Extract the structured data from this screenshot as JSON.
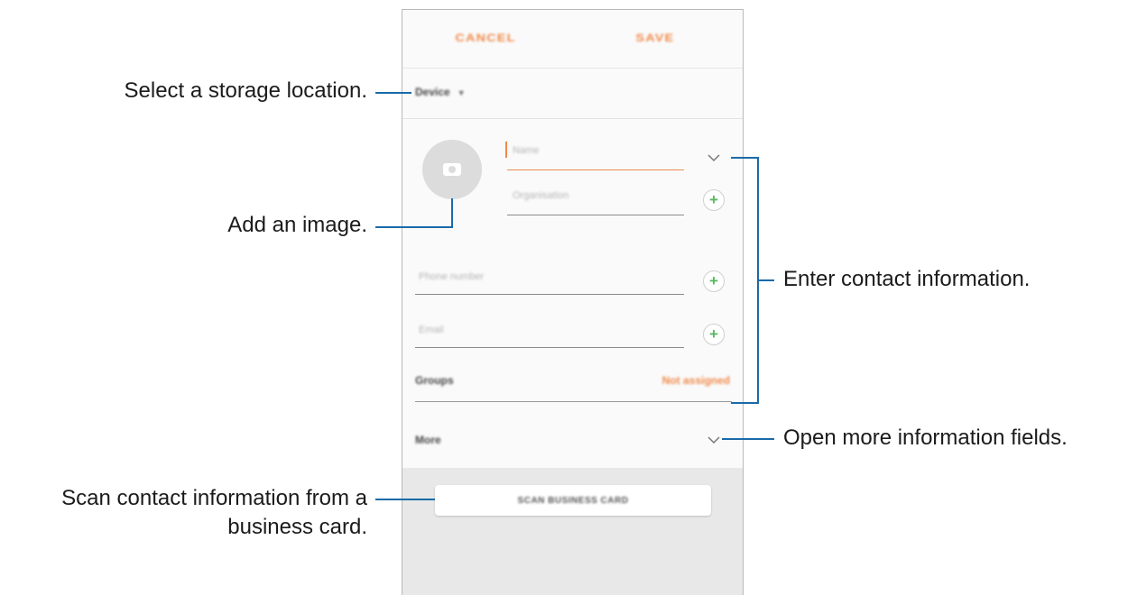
{
  "header": {
    "cancel_label": "CANCEL",
    "save_label": "SAVE"
  },
  "storage": {
    "label": "Device",
    "icon": "dropdown-triangle-icon"
  },
  "form": {
    "avatar_icon": "camera-icon",
    "name_placeholder": "Name",
    "organisation_placeholder": "Organisation",
    "phone_placeholder": "Phone number",
    "email_placeholder": "Email",
    "groups_label": "Groups",
    "groups_value": "Not assigned",
    "more_label": "More",
    "scan_button_label": "SCAN BUSINESS CARD"
  },
  "colors": {
    "accent": "#f08a4b",
    "add_icon": "#5ab862",
    "leader_line": "#1a6aa8"
  },
  "callouts": {
    "storage": "Select a storage location.",
    "image": "Add an image.",
    "contact_info": "Enter contact information.",
    "more_fields": "Open more information fields.",
    "scan_line1": "Scan contact information from a",
    "scan_line2": "business card."
  }
}
